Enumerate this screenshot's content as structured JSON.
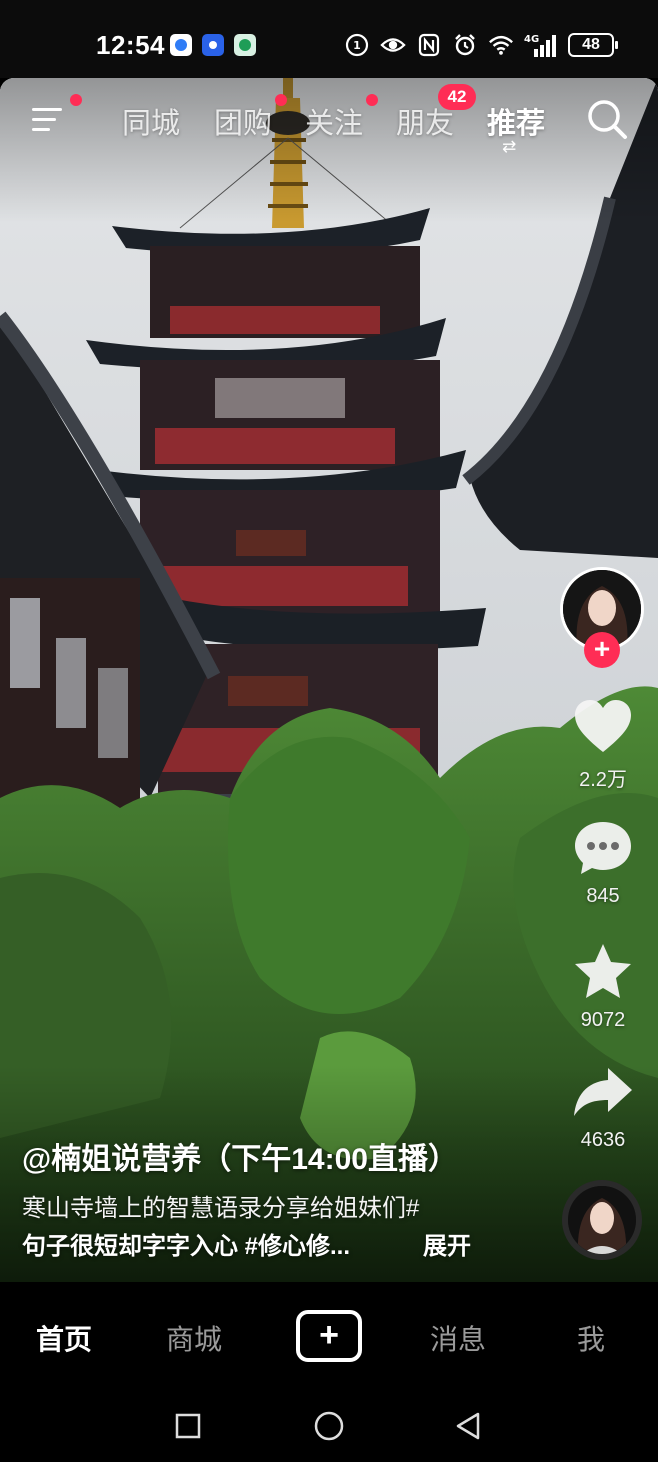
{
  "status_bar": {
    "time": "12:54",
    "network": "4G",
    "battery": "48",
    "icons": [
      "browser-app-icon",
      "security-app-icon",
      "phone-manager-icon",
      "privacy-icon",
      "eye-comfort-icon",
      "nfc-icon",
      "alarm-icon",
      "wifi-icon",
      "cellular-signal-icon"
    ]
  },
  "top_nav": {
    "tabs": [
      "同城",
      "团购",
      "关注",
      "朋友",
      "推荐"
    ],
    "active_tab": "推荐",
    "friends_badge": "42",
    "accent_color": "#ff2d55"
  },
  "rail": {
    "follow_label": "+",
    "likes": "2.2万",
    "comments": "845",
    "favorites": "9072",
    "shares": "4636"
  },
  "caption": {
    "author": "@楠姐说营养（下午14:00直播）",
    "line1": "寒山寺墙上的智慧语录分享给姐妹们#",
    "line2": "句子很短却字字入心 #修心修...",
    "expand": "展开"
  },
  "bottom_nav": {
    "home": "首页",
    "mall": "商城",
    "create": "+",
    "messages": "消息",
    "me": "我"
  },
  "system_nav": [
    "recent-apps-button",
    "home-button",
    "back-button"
  ]
}
